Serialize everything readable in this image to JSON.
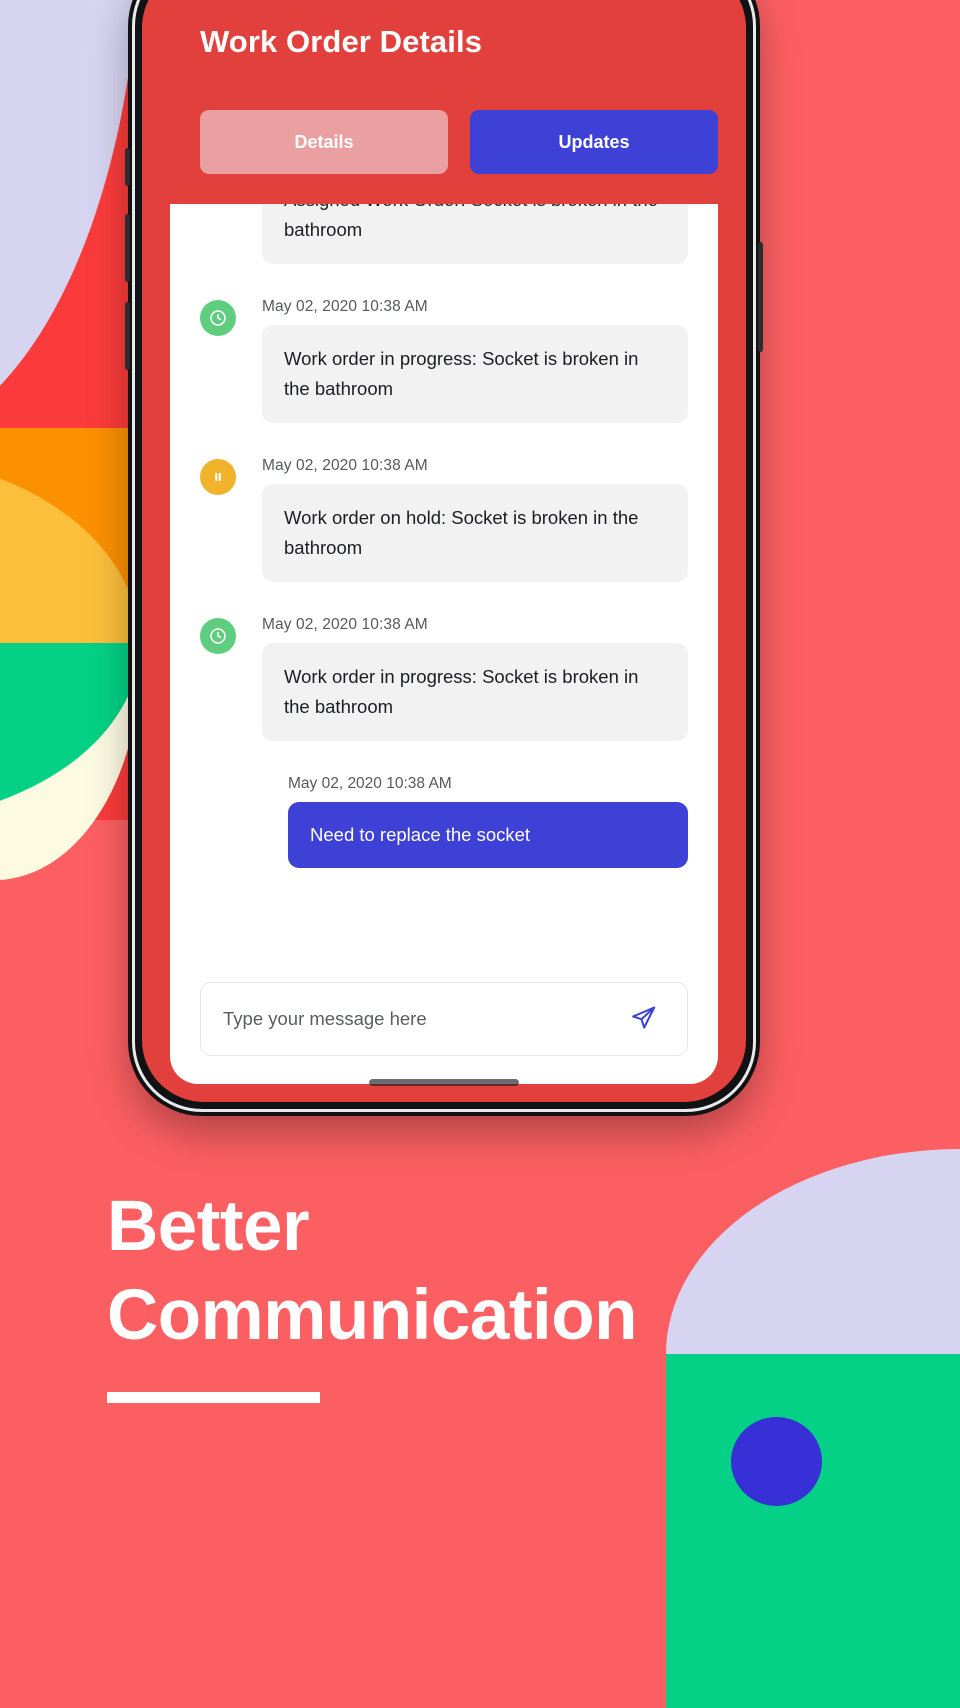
{
  "theme": {
    "bg": "#fc5f62",
    "header_red": "#e1403c",
    "accent_blue": "#3d41d6",
    "green": "#5fcd7f",
    "amber": "#f2b32c",
    "dark": "#3d3f43",
    "lavender": "#d6d4f0",
    "cream": "#fdfae2",
    "orange": "#fb9001",
    "yellow": "#fcbe3b",
    "mint": "#04d185"
  },
  "app": {
    "title": "Work Order Details",
    "tabs": [
      {
        "label": "Details",
        "active": false,
        "name": "tab-details"
      },
      {
        "label": "Updates",
        "active": true,
        "name": "tab-updates"
      }
    ]
  },
  "chat": {
    "messages": [
      {
        "icon": "assigned-icon",
        "icon_kind": "assigned",
        "timestamp": "",
        "text": "Assigned Work Order: Socket is broken in the bathroom",
        "direction": "in"
      },
      {
        "icon": "clock-icon",
        "icon_kind": "progress",
        "timestamp": "May 02, 2020  10:38 AM",
        "text": "Work order in progress: Socket is broken in the bathroom",
        "direction": "in"
      },
      {
        "icon": "pause-icon",
        "icon_kind": "hold",
        "timestamp": "May 02, 2020  10:38 AM",
        "text": "Work order on hold: Socket is broken in the bathroom",
        "direction": "in"
      },
      {
        "icon": "clock-icon",
        "icon_kind": "progress",
        "timestamp": "May 02, 2020  10:38 AM",
        "text": "Work order in progress: Socket is broken in the bathroom",
        "direction": "in"
      },
      {
        "icon": "",
        "icon_kind": "",
        "timestamp": "May 02, 2020  10:38 AM",
        "text": "Need to replace the socket",
        "direction": "out"
      }
    ]
  },
  "composer": {
    "placeholder": "Type your message here",
    "value": "",
    "send_icon": "send-icon"
  },
  "promo": {
    "headline_line1": "Better",
    "headline_line2": "Communication"
  }
}
